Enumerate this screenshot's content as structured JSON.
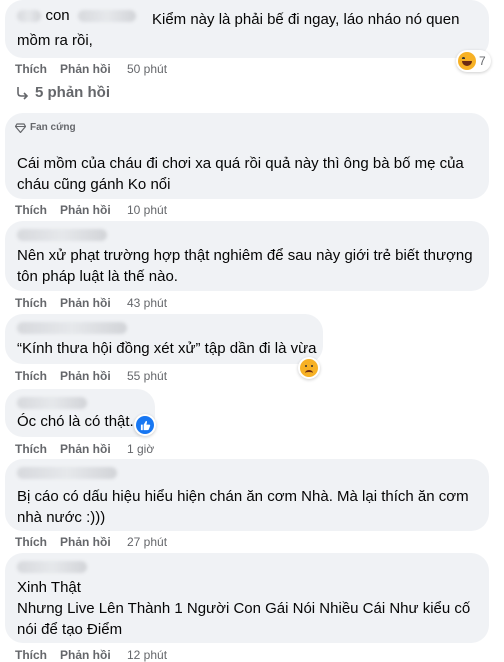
{
  "actions": {
    "like": "Thích",
    "reply": "Phản hồi"
  },
  "comments": [
    {
      "name_visible": "con",
      "text": "Kiểm này là phải bế đi ngay, láo nháo nó quen mồm ra rồi,",
      "time": "50 phút",
      "reaction_count": "7",
      "reaction": "haha"
    },
    {
      "badge": "Fan cứng",
      "text": "Cái mồm của cháu đi chơi xa quá rồi quả này thì ông bà bố mẹ của cháu cũng gánh Ko nổi",
      "time": "10 phút"
    },
    {
      "text": "Nên xử phạt trường hợp thật nghiêm để sau này giới trẻ biết thượng tôn pháp luật là thế nào.",
      "time": "43 phút"
    },
    {
      "text": "“Kính thưa hội đồng xét xử” tập dần đi là vừa",
      "time": "55 phút",
      "reaction": "sad"
    },
    {
      "text": "Óc chó là có thật.",
      "time": "1 giờ",
      "reaction": "like"
    },
    {
      "text": "Bị cáo có dấu hiệu hiểu hiện chán ăn cơm Nhà. Mà lại thích ăn cơm nhà nước :)))",
      "time": "27 phút"
    },
    {
      "name_visible": "Xinh Thật",
      "text": "Nhưng Live Lên Thành 1 Người Con Gái Nói Nhiều Cái Như kiểu cố nói để tạo Điểm",
      "time": "12 phút"
    }
  ],
  "replies_link": "5 phản hồi",
  "colors": {
    "bubble": "#f0f2f5",
    "meta": "#65676b",
    "like_blue": "#1877f2",
    "emoji": "#f7b125"
  }
}
